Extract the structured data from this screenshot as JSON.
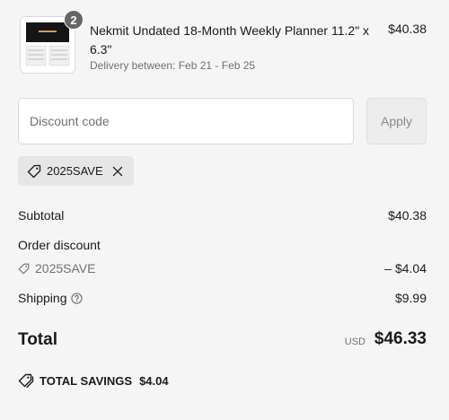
{
  "product": {
    "quantity": "2",
    "name": "Nekmit Undated 18-Month Weekly Planner 11.2\" x 6.3\"",
    "delivery": "Delivery between: Feb 21 - Feb 25",
    "price": "$40.38",
    "thumbnail_icon": "planner-thumbnail"
  },
  "discount": {
    "placeholder": "Discount code",
    "apply_label": "Apply",
    "applied_code": "2025SAVE",
    "tag_icon": "tag-icon",
    "remove_icon": "close-icon"
  },
  "summary": {
    "subtotal_label": "Subtotal",
    "subtotal_value": "$40.38",
    "order_discount_label": "Order discount",
    "discount_code": "2025SAVE",
    "discount_value": "– $4.04",
    "shipping_label": "Shipping",
    "shipping_value": "$9.99",
    "shipping_help_icon": "question-circle-icon",
    "total_label": "Total",
    "currency": "USD",
    "total_value": "$46.33",
    "savings_label": "TOTAL SAVINGS",
    "savings_value": "$4.04"
  },
  "colors": {
    "background": "#f5f5f5",
    "badge": "#666666",
    "muted_text": "#707070"
  }
}
